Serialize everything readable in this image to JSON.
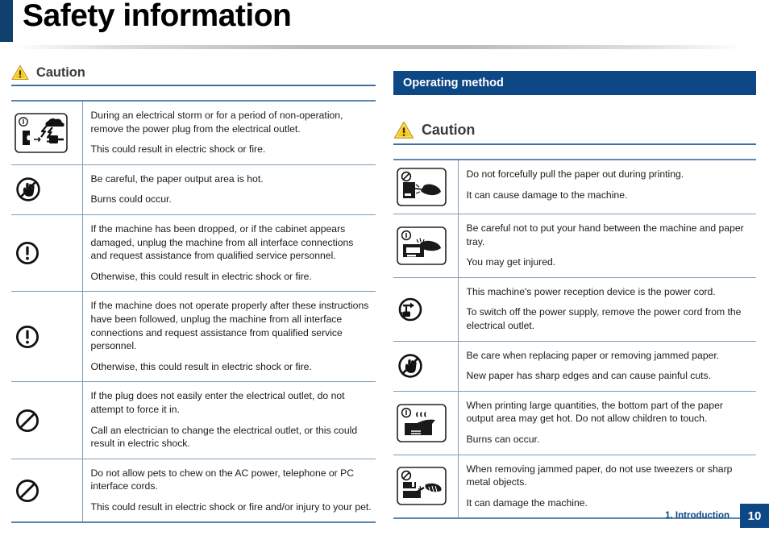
{
  "document": {
    "title": "Safety information"
  },
  "left_column": {
    "caution_heading": "Caution",
    "rows": [
      {
        "icon": "storm-unplug-pictogram",
        "lines": [
          "During an electrical storm or for a period of non-operation, remove the power plug from the electrical outlet.",
          "This could result in electric shock or fire."
        ]
      },
      {
        "icon": "no-touch-hand-icon",
        "lines": [
          "Be careful, the paper output area is hot.",
          "Burns could occur."
        ]
      },
      {
        "icon": "exclamation-circle-icon",
        "lines": [
          "If the machine has been dropped, or if the cabinet appears damaged, unplug the machine from all interface connections and request assistance from qualified service personnel.",
          "Otherwise, this could result in electric shock or fire."
        ]
      },
      {
        "icon": "exclamation-circle-icon",
        "lines": [
          "If the machine does not operate properly after these instructions have been followed, unplug the machine from all interface connections and request assistance from qualified service personnel.",
          "Otherwise, this could result in electric shock or fire."
        ]
      },
      {
        "icon": "prohibition-circle-icon",
        "lines": [
          "If the plug does not easily enter the electrical outlet, do not attempt to force it in.",
          "Call an electrician to change the electrical outlet, or this could result in electric shock."
        ]
      },
      {
        "icon": "prohibition-circle-icon",
        "lines": [
          "Do not allow pets to chew on the AC power, telephone or PC interface cords.",
          "This could result in electric shock or fire and/or injury to your pet."
        ]
      }
    ]
  },
  "right_column": {
    "section_banner": "Operating method",
    "caution_heading": "Caution",
    "rows": [
      {
        "icon": "no-pull-paper-pictogram",
        "lines": [
          "Do not forcefully pull the paper out during printing.",
          "It can cause damage to the machine."
        ]
      },
      {
        "icon": "hand-pinch-tray-pictogram",
        "lines": [
          "Be careful not to put your hand between the machine and paper tray.",
          "You may get injured."
        ]
      },
      {
        "icon": "unplug-power-cord-icon",
        "lines": [
          "This machine's power reception device is the power cord.",
          "To switch off the power supply, remove the power cord from the electrical outlet."
        ]
      },
      {
        "icon": "no-touch-hand-icon",
        "lines": [
          "Be care when replacing paper or removing jammed paper.",
          "New paper has sharp edges and can cause painful cuts."
        ]
      },
      {
        "icon": "hot-surface-printer-pictogram",
        "lines": [
          "When printing large quantities, the bottom part of the paper output area may get hot. Do not allow children to touch.",
          "Burns can occur."
        ]
      },
      {
        "icon": "no-tweezers-pictogram",
        "lines": [
          "When removing jammed paper, do not use tweezers or sharp metal objects.",
          "It can damage the machine."
        ]
      }
    ]
  },
  "footer": {
    "chapter": "1. Introduction",
    "page_number": "10"
  },
  "colors": {
    "accent_navy": "#10416e",
    "banner_blue": "#0d4785",
    "rule_blue": "#3f6fa4",
    "table_border": "#7d9dbc",
    "warning_yellow": "#f5c518"
  }
}
